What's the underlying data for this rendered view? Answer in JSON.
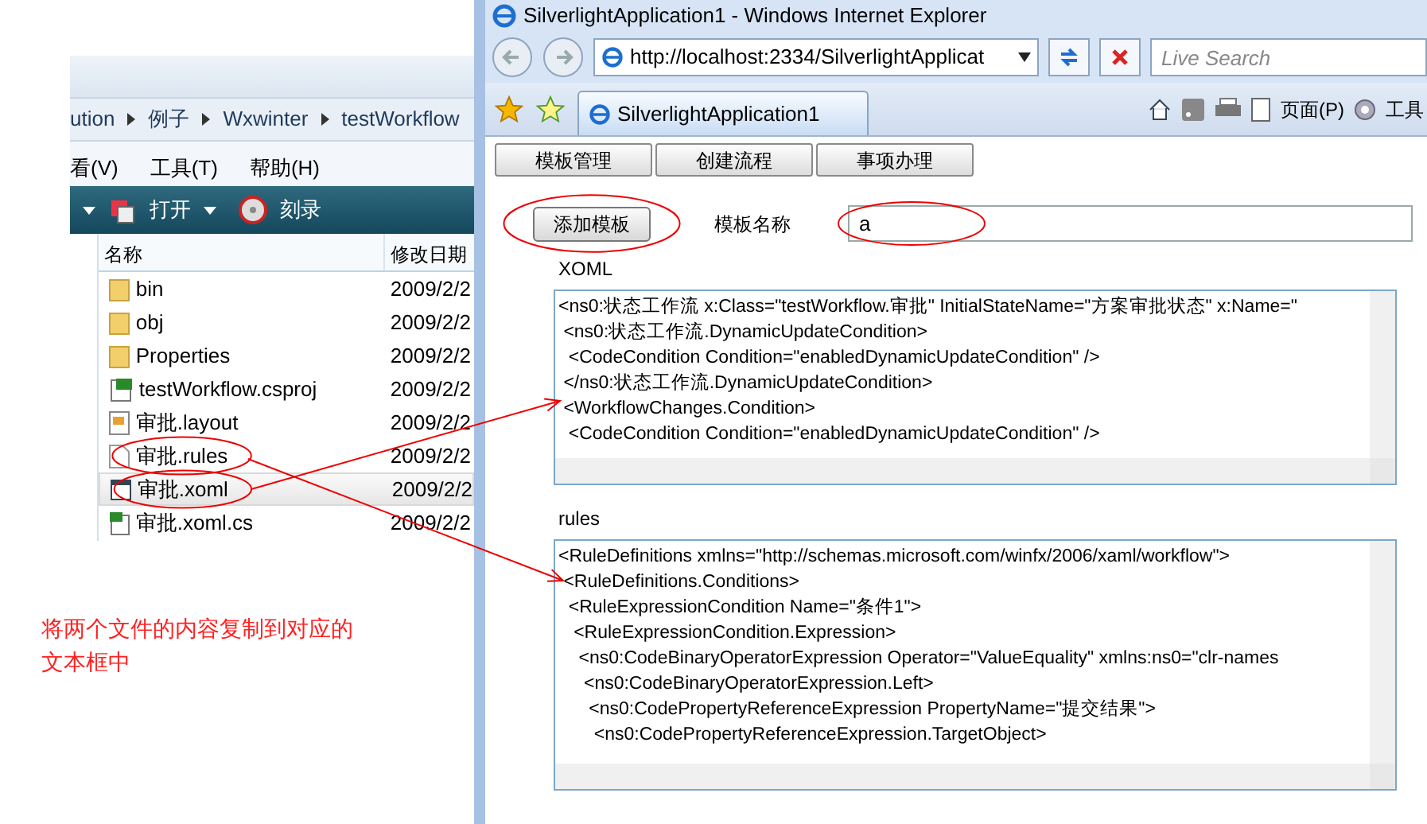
{
  "explorer": {
    "breadcrumb": [
      "ution",
      "例子",
      "Wxwinter",
      "testWorkflow"
    ],
    "menu": [
      "看(V)",
      "工具(T)",
      "帮助(H)"
    ],
    "toolbar": [
      {
        "label": "打开",
        "kind": "open"
      },
      {
        "label": "刻录",
        "kind": "burn"
      }
    ],
    "columns": [
      "名称",
      "修改日期"
    ],
    "files": [
      {
        "name": "bin",
        "kind": "folder",
        "date": "2009/2/2",
        "selected": false
      },
      {
        "name": "obj",
        "kind": "folder",
        "date": "2009/2/2",
        "selected": false
      },
      {
        "name": "Properties",
        "kind": "folder",
        "date": "2009/2/2",
        "selected": false
      },
      {
        "name": "testWorkflow.csproj",
        "kind": "project",
        "date": "2009/2/2",
        "selected": false
      },
      {
        "name": "审批.layout",
        "kind": "layout",
        "date": "2009/2/2",
        "selected": false
      },
      {
        "name": "审批.rules",
        "kind": "file",
        "date": "2009/2/2",
        "selected": false
      },
      {
        "name": "审批.xoml",
        "kind": "xoml",
        "date": "2009/2/2",
        "selected": true
      },
      {
        "name": "审批.xoml.cs",
        "kind": "code",
        "date": "2009/2/2",
        "selected": false
      }
    ]
  },
  "note": "将两个文件的内容复制到对应的文本框中",
  "browser": {
    "title": "SilverlightApplication1 - Windows Internet Explorer",
    "address": "http://localhost:2334/SilverlightApplicat",
    "search": {
      "placeholder": "Live Search"
    },
    "tab": "SilverlightApplication1",
    "commands": [
      "页面(P)",
      "工具"
    ],
    "app": {
      "nav": [
        "模板管理",
        "创建流程",
        "事项办理"
      ],
      "add_button": "添加模板",
      "name_label": "模板名称",
      "name_value": "a",
      "xoml_label": "XOML",
      "xoml_lines": [
        "<ns0:状态工作流 x:Class=\"testWorkflow.审批\" InitialStateName=\"方案审批状态\" x:Name=\"",
        " <ns0:状态工作流.DynamicUpdateCondition>",
        "  <CodeCondition Condition=\"enabledDynamicUpdateCondition\" />",
        " </ns0:状态工作流.DynamicUpdateCondition>",
        " <WorkflowChanges.Condition>",
        "  <CodeCondition Condition=\"enabledDynamicUpdateCondition\" />"
      ],
      "rules_label": "rules",
      "rules_lines": [
        "<RuleDefinitions xmlns=\"http://schemas.microsoft.com/winfx/2006/xaml/workflow\">",
        " <RuleDefinitions.Conditions>",
        "  <RuleExpressionCondition Name=\"条件1\">",
        "   <RuleExpressionCondition.Expression>",
        "    <ns0:CodeBinaryOperatorExpression Operator=\"ValueEquality\" xmlns:ns0=\"clr-names",
        "     <ns0:CodeBinaryOperatorExpression.Left>",
        "      <ns0:CodePropertyReferenceExpression PropertyName=\"提交结果\">",
        "       <ns0:CodePropertyReferenceExpression.TargetObject>"
      ]
    }
  }
}
